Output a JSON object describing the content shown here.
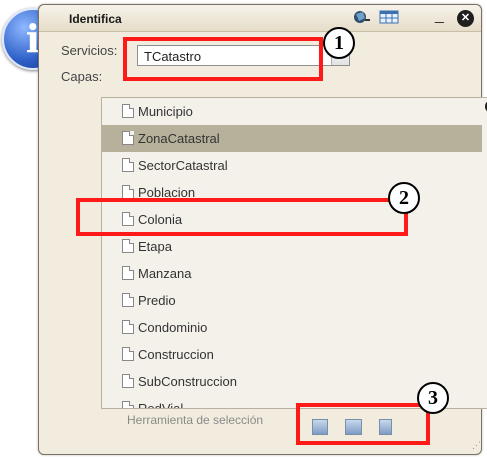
{
  "window": {
    "title": "Identifica"
  },
  "services": {
    "label": "Servicios:",
    "selected": "TCatastro"
  },
  "layers": {
    "label": "Capas:",
    "items": [
      {
        "label": "Municipio"
      },
      {
        "label": "ZonaCatastral",
        "selected": true
      },
      {
        "label": "SectorCatastral"
      },
      {
        "label": "Poblacion"
      },
      {
        "label": "Colonia"
      },
      {
        "label": "Etapa"
      },
      {
        "label": "Manzana"
      },
      {
        "label": "Predio"
      },
      {
        "label": "Condominio"
      },
      {
        "label": "Construccion"
      },
      {
        "label": "SubConstruccion"
      },
      {
        "label": "RedVial"
      }
    ]
  },
  "footer": {
    "selection_tool_label": "Herramienta de selección"
  },
  "annotations": [
    {
      "number": "1",
      "color": "#ff1a1a"
    },
    {
      "number": "2",
      "color": "#ff1a1a"
    },
    {
      "number": "3",
      "color": "#ff1a1a"
    }
  ],
  "icons": [
    "info-icon",
    "identify-tool-icon",
    "table-icon",
    "minimize-icon",
    "close-icon",
    "dropdown-arrow-icon",
    "document-icon",
    "scroll-up-icon",
    "point-select-icon",
    "rectangle-select-icon",
    "clear-select-icon"
  ],
  "colors": {
    "window_bg": "#f2ecdf",
    "selected_row": "#b7b09a",
    "annotation": "#ff1a1a"
  }
}
